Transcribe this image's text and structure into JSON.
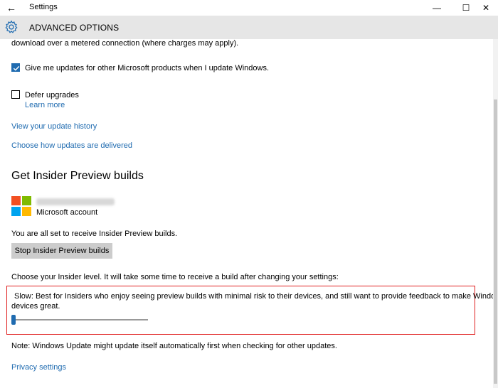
{
  "window": {
    "title": "Settings",
    "back_icon": "back-arrow-icon",
    "controls": [
      "minimize",
      "maximize",
      "close"
    ]
  },
  "header": {
    "title": "ADVANCED OPTIONS",
    "icon": "gear-icon"
  },
  "content": {
    "metered_text": "download over a metered connection (where charges may apply).",
    "ms_updates_checkbox": {
      "label": "Give me updates for other Microsoft products when I update Windows.",
      "checked": true
    },
    "defer_checkbox": {
      "label": "Defer upgrades",
      "checked": false
    },
    "learn_more": "Learn more",
    "view_history": "View your update history",
    "choose_delivery": "Choose how updates are delivered",
    "insider_heading": "Get Insider Preview builds",
    "account_label": "Microsoft account",
    "all_set_text": "You are all set to receive Insider Preview builds.",
    "stop_button": "Stop Insider Preview builds",
    "choose_level_text": "Choose your Insider level. It will take some time to receive a build after changing your settings:",
    "slow_desc_line1": "Slow: Best for Insiders who enjoy seeing preview builds with minimal risk to their devices, and still want to provide feedback to make Windows",
    "slow_desc_line2": "devices great.",
    "insider_level": 0,
    "note_text": "Note: Windows Update might update itself automatically first when checking for other updates.",
    "privacy_settings": "Privacy settings"
  },
  "colors": {
    "accent": "#1f6bb0",
    "highlight_box": "#e02020",
    "header_bg": "#e6e6e6"
  }
}
